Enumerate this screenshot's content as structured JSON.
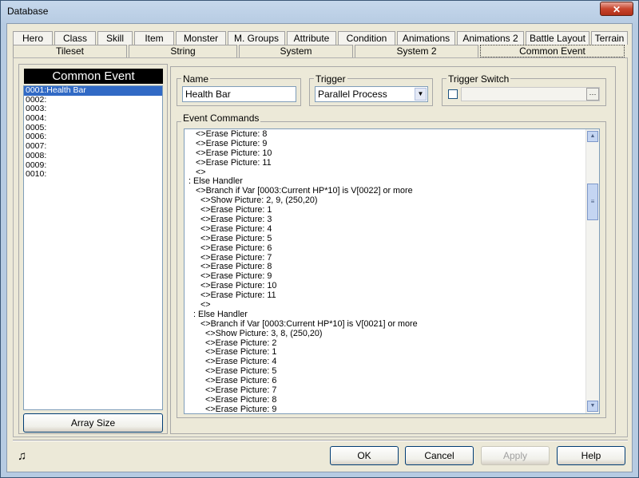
{
  "window": {
    "title": "Database",
    "close_label": "✕"
  },
  "tabs_row1": [
    "Hero",
    "Class",
    "Skill",
    "Item",
    "Monster",
    "M. Groups",
    "Attribute",
    "Condition",
    "Animations",
    "Animations 2",
    "Battle Layout",
    "Terrain"
  ],
  "tabs_row2": [
    "Tileset",
    "String",
    "System",
    "System 2",
    "Common Event"
  ],
  "left": {
    "header": "Common Event",
    "items": [
      "0001:Health Bar",
      "0002:",
      "0003:",
      "0004:",
      "0005:",
      "0006:",
      "0007:",
      "0008:",
      "0009:",
      "0010:"
    ],
    "array_size_label": "Array Size"
  },
  "name": {
    "label": "Name",
    "value": "Health Bar"
  },
  "trigger": {
    "label": "Trigger",
    "value": "Parallel Process"
  },
  "trigger_switch": {
    "label": "Trigger Switch",
    "value": "",
    "browse": "···"
  },
  "event_commands": {
    "label": "Event Commands",
    "lines": [
      "    <>Erase Picture: 8",
      "    <>Erase Picture: 9",
      "    <>Erase Picture: 10",
      "    <>Erase Picture: 11",
      "    <>",
      " : Else Handler",
      "    <>Branch if Var [0003:Current HP*10] is V[0022] or more",
      "      <>Show Picture: 2, 9, (250,20)",
      "      <>Erase Picture: 1",
      "      <>Erase Picture: 3",
      "      <>Erase Picture: 4",
      "      <>Erase Picture: 5",
      "      <>Erase Picture: 6",
      "      <>Erase Picture: 7",
      "      <>Erase Picture: 8",
      "      <>Erase Picture: 9",
      "      <>Erase Picture: 10",
      "      <>Erase Picture: 11",
      "      <>",
      "   : Else Handler",
      "      <>Branch if Var [0003:Current HP*10] is V[0021] or more",
      "        <>Show Picture: 3, 8, (250,20)",
      "        <>Erase Picture: 2",
      "        <>Erase Picture: 1",
      "        <>Erase Picture: 4",
      "        <>Erase Picture: 5",
      "        <>Erase Picture: 6",
      "        <>Erase Picture: 7",
      "        <>Erase Picture: 8",
      "        <>Erase Picture: 9"
    ]
  },
  "buttons": {
    "ok": "OK",
    "cancel": "Cancel",
    "apply": "Apply",
    "help": "Help"
  },
  "icons": {
    "music": "♫",
    "scroll_up": "▲",
    "scroll_down": "▼",
    "grip": "≡",
    "dropdown": "▼"
  }
}
